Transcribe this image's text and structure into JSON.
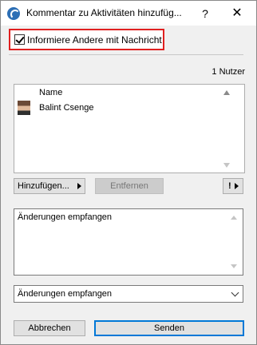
{
  "window": {
    "title": "Kommentar zu Aktivitäten hinzufüg...",
    "help_label": "?",
    "close_label": "✕"
  },
  "notify": {
    "label": "Informiere Andere mit Nachricht",
    "checked": true
  },
  "users": {
    "count_label": "1 Nutzer",
    "column_header": "Name",
    "items": [
      {
        "name": "Balint Csenge"
      }
    ]
  },
  "buttons": {
    "add_label": "Hinzufügen...",
    "remove_label": "Entfernen",
    "alert_label": "!",
    "cancel_label": "Abbrechen",
    "send_label": "Senden"
  },
  "message": {
    "text": "Änderungen empfangen"
  },
  "topic_select": {
    "value": "Änderungen empfangen"
  },
  "colors": {
    "highlight": "#e02020",
    "accent": "#0078d7",
    "title_icon": "#2d6fb5"
  }
}
